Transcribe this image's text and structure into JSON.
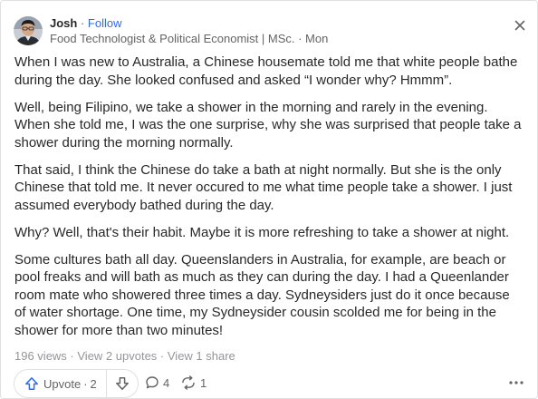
{
  "author": {
    "name": "Josh",
    "separator": " · ",
    "follow_label": "Follow",
    "credential": "Food Technologist & Political Economist | MSc. · Mon",
    "avatar_icon": "user-avatar-photo"
  },
  "close_icon": "close-icon",
  "post": {
    "paragraphs": [
      "When I was new to Australia, a Chinese housemate told me that white people bathe during the day. She looked confused and asked “I wonder why? Hmmm”.",
      "Well, being Filipino, we take a shower in the morning and rarely in the evening. When she told me, I was the one surprise, why she was surprised that people take a shower during the morning normally.",
      "That said, I think the Chinese do take a bath at night normally. But she is the only Chinese that told me. It never occured to me what time people take a shower. I just assumed everybody bathed during the day.",
      "Why? Well, that's their habit. Maybe it is more refreshing to take a shower at night.",
      "Some cultures bath all day. Queenslanders in Australia, for example, are beach or pool freaks and will bath as much as they can during the day. I had a Queenlander room mate who showered three times a day. Sydneysiders just do it once because of water shortage. One time, my Sydneysider cousin scolded me for being in the shower for more than two minutes!"
    ]
  },
  "stats": {
    "views": "196 views",
    "upvotes": "View 2 upvotes",
    "shares": "View 1 share",
    "separator": " · "
  },
  "actions": {
    "upvote_label": "Upvote",
    "upvote_separator": "·",
    "upvote_count": "2",
    "comment_count": "4",
    "share_count": "1"
  },
  "colors": {
    "accent_blue": "#2e69ff",
    "text_primary": "#282829",
    "text_secondary": "#636466",
    "text_muted": "#939598",
    "border": "#dee0e1"
  }
}
